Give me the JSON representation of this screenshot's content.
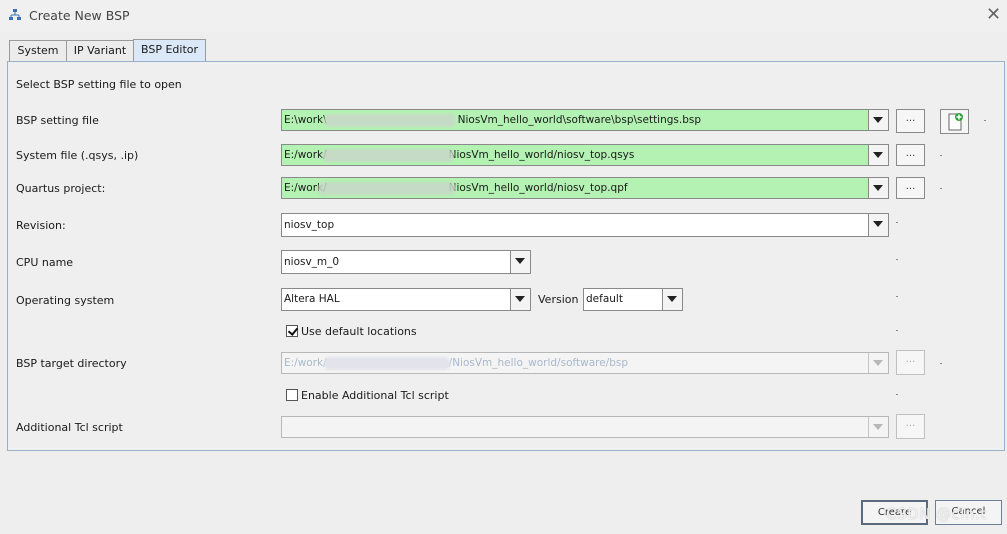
{
  "window": {
    "title": "Create New BSP"
  },
  "tabs": [
    {
      "label": "System",
      "active": false
    },
    {
      "label": "IP Variant",
      "active": false
    },
    {
      "label": "BSP Editor",
      "active": true
    }
  ],
  "form": {
    "heading": "Select BSP setting file to open",
    "bsp_setting_file": {
      "label": "BSP setting file",
      "value_prefix": "E:\\work\\",
      "value_suffix": "NiosVm_hello_world\\software\\bsp\\settings.bsp",
      "browse": "..."
    },
    "system_file": {
      "label": "System file (.qsys, .ip)",
      "value_prefix": "E:/work/",
      "value_suffix": "NiosVm_hello_world/niosv_top.qsys",
      "browse": "..."
    },
    "quartus_project": {
      "label": "Quartus project:",
      "value_prefix": "E:/work/",
      "value_suffix": "NiosVm_hello_world/niosv_top.qpf",
      "browse": "..."
    },
    "revision": {
      "label": "Revision:",
      "value": "niosv_top"
    },
    "cpu_name": {
      "label": "CPU name",
      "value": "niosv_m_0"
    },
    "operating_system": {
      "label": "Operating system",
      "value": "Altera HAL",
      "version_label": "Version",
      "version_value": "default"
    },
    "use_default_locations": {
      "label": "Use default locations",
      "checked": true
    },
    "bsp_target_directory": {
      "label": "BSP target directory",
      "value_prefix": "E:/work/",
      "value_suffix": "/NiosVm_hello_world/software/bsp",
      "browse": "...",
      "enabled": false
    },
    "enable_tcl": {
      "label": "Enable Additional Tcl script",
      "checked": false
    },
    "additional_tcl": {
      "label": "Additional Tcl script",
      "value": "",
      "browse": "...",
      "enabled": false
    }
  },
  "buttons": {
    "create": "Create",
    "cancel": "Cancel"
  },
  "watermark": "CSDN @cln.t",
  "colors": {
    "valid_field": "#b3f2b3",
    "active_tab": "#dbe8f7",
    "panel_border": "#9ab0c8"
  }
}
